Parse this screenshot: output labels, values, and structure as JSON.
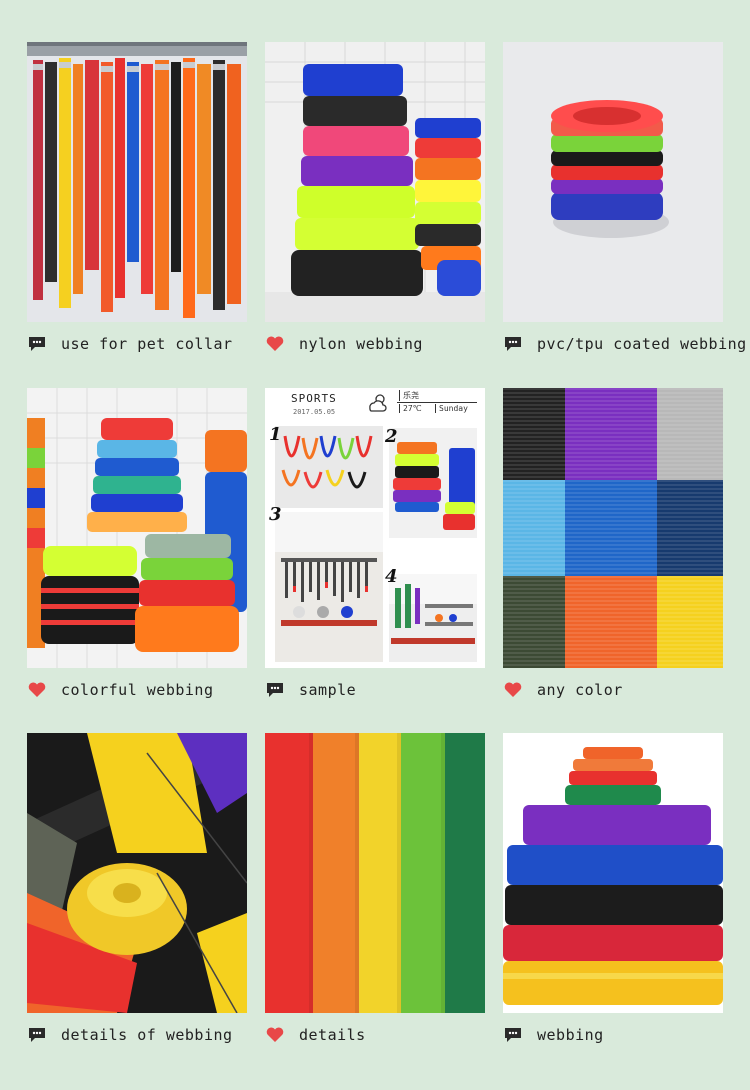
{
  "page": {
    "background": "#d9eadb"
  },
  "tiles": [
    {
      "caption": "use for pet collar",
      "icon": "chat-bubble-icon"
    },
    {
      "caption": "nylon webbing",
      "icon": "heart-icon"
    },
    {
      "caption": "pvc/tpu coated webbing",
      "icon": "chat-bubble-icon"
    },
    {
      "caption": "colorful webbing",
      "icon": "heart-icon"
    },
    {
      "caption": "sample",
      "icon": "chat-bubble-icon"
    },
    {
      "caption": "any color",
      "icon": "heart-icon"
    },
    {
      "caption": "details of webbing",
      "icon": "chat-bubble-icon"
    },
    {
      "caption": "details",
      "icon": "heart-icon"
    },
    {
      "caption": "webbing",
      "icon": "chat-bubble-icon"
    }
  ],
  "sample_card": {
    "title": "SPORTS",
    "date": "2017.05.05",
    "weather_symbol": "乐尧",
    "temperature": "27℃",
    "day": "Sunday",
    "step_numbers": [
      "1",
      "2",
      "3",
      "4"
    ]
  },
  "colors": {
    "heart": "#e84848",
    "bubble": "#2a2a2a",
    "swatches": [
      "#222222",
      "#7a2fc0",
      "#b8b8b8",
      "#5ab6e6",
      "#1f66c8",
      "#173a6e",
      "#3c4a34",
      "#f0642a",
      "#f5d11e"
    ],
    "rainbow": [
      "#e8312e",
      "#f0802a",
      "#f2d32a",
      "#6cc23a",
      "#1f7a48"
    ]
  }
}
